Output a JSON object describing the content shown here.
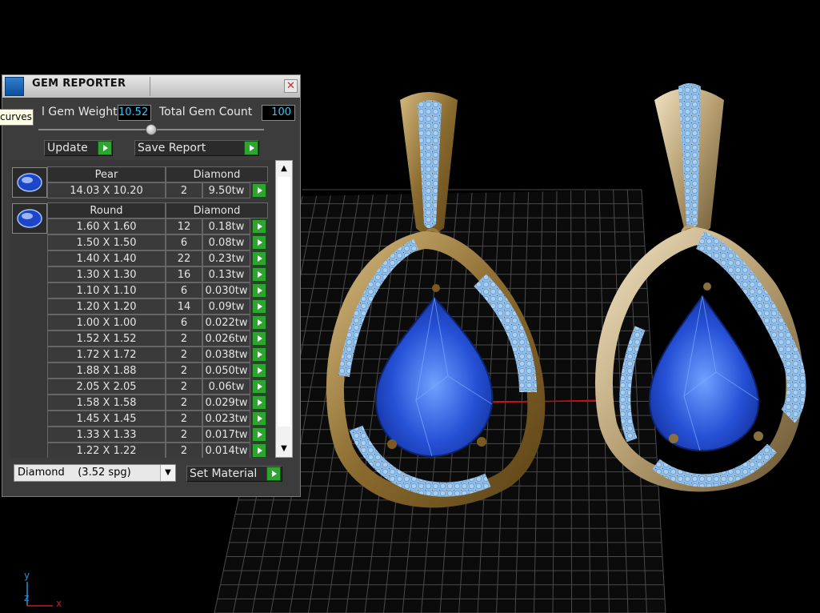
{
  "panel": {
    "title": "GEM REPORTER",
    "close": "✕",
    "total_weight_label": "l Gem Weight",
    "total_weight_value": "10.52",
    "total_count_label": "Total Gem Count",
    "total_count_value": "100",
    "tooltip": "curves",
    "update_label": "Update",
    "save_report_label": "Save Report",
    "material_select": "Diamond    (3.52 spg)",
    "set_material_label": "Set Material"
  },
  "groups": [
    {
      "shape": "Pear",
      "material": "Diamond",
      "rows": [
        {
          "size": "14.03 X 10.20",
          "count": "2",
          "weight": "9.50tw"
        }
      ]
    },
    {
      "shape": "Round",
      "material": "Diamond",
      "rows": [
        {
          "size": "1.60 X 1.60",
          "count": "12",
          "weight": "0.18tw"
        },
        {
          "size": "1.50 X 1.50",
          "count": "6",
          "weight": "0.08tw"
        },
        {
          "size": "1.40 X 1.40",
          "count": "22",
          "weight": "0.23tw"
        },
        {
          "size": "1.30 X 1.30",
          "count": "16",
          "weight": "0.13tw"
        },
        {
          "size": "1.10 X 1.10",
          "count": "6",
          "weight": "0.030tw"
        },
        {
          "size": "1.20 X 1.20",
          "count": "14",
          "weight": "0.09tw"
        },
        {
          "size": "1.00 X 1.00",
          "count": "6",
          "weight": "0.022tw"
        },
        {
          "size": "1.52 X 1.52",
          "count": "2",
          "weight": "0.026tw"
        },
        {
          "size": "1.72 X 1.72",
          "count": "2",
          "weight": "0.038tw"
        },
        {
          "size": "1.88 X 1.88",
          "count": "2",
          "weight": "0.050tw"
        },
        {
          "size": "2.05 X 2.05",
          "count": "2",
          "weight": "0.06tw"
        },
        {
          "size": "1.58 X 1.58",
          "count": "2",
          "weight": "0.029tw"
        },
        {
          "size": "1.45 X 1.45",
          "count": "2",
          "weight": "0.023tw"
        },
        {
          "size": "1.33 X 1.33",
          "count": "2",
          "weight": "0.017tw"
        },
        {
          "size": "1.22 X 1.22",
          "count": "2",
          "weight": "0.014tw"
        }
      ]
    }
  ],
  "viewport": {
    "axis_x": "x",
    "axis_y": "y",
    "axis_z": "z"
  },
  "colors": {
    "gem_blue": "#1e44c8",
    "pave_blue": "#8fbde8",
    "gold": "#8a6a2e",
    "gold_light": "#c7ab74",
    "grid_line": "#4a4a4a",
    "accent_green": "#2da630",
    "value_cyan": "#37c4f4"
  }
}
